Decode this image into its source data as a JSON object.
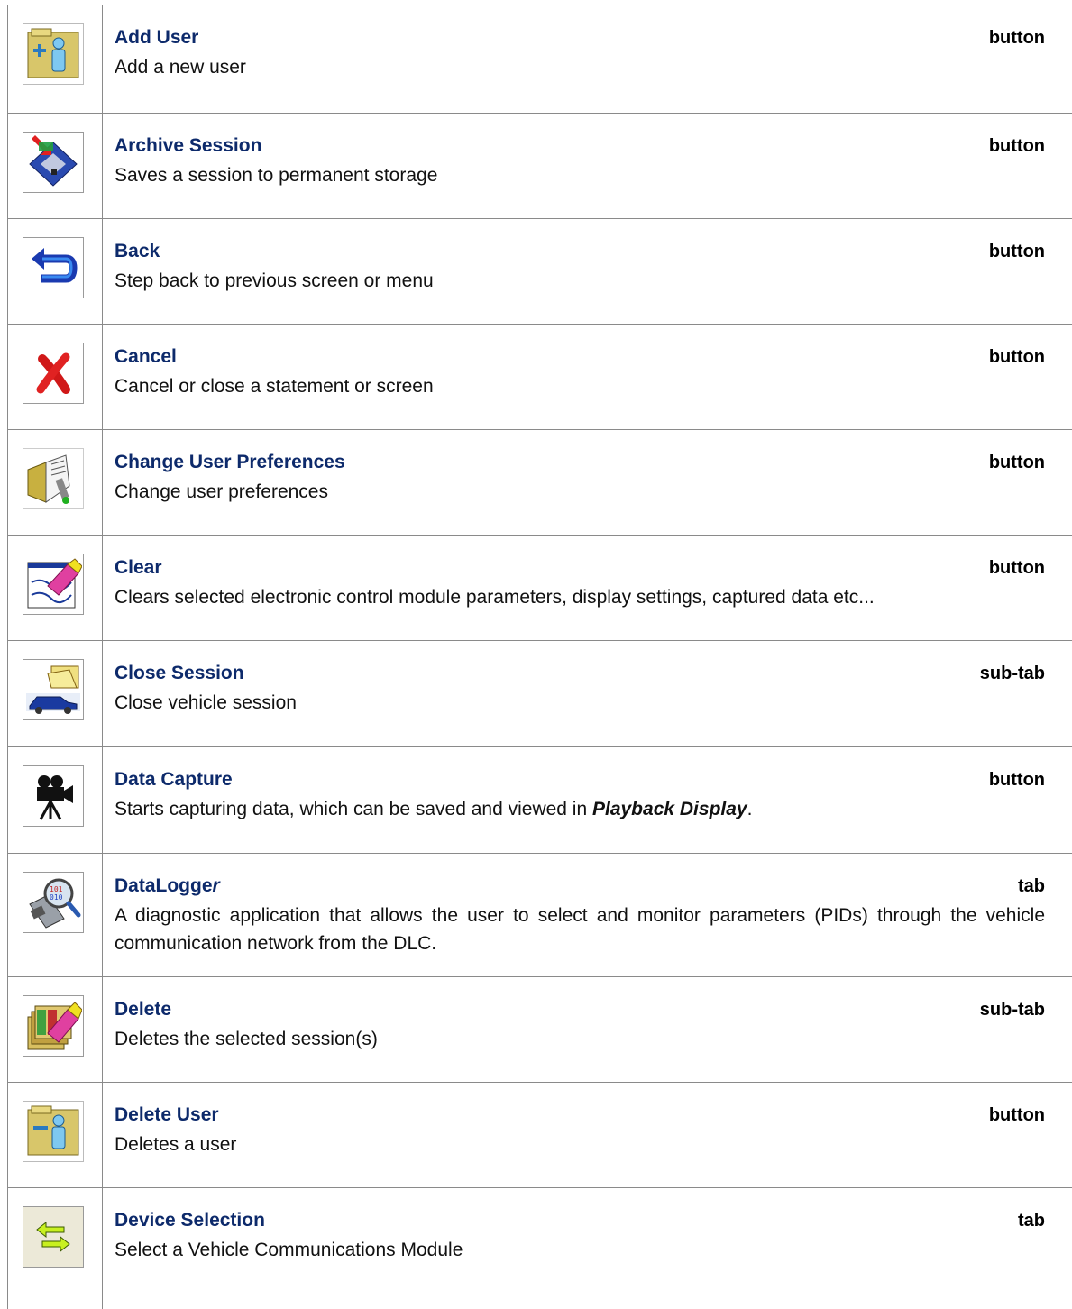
{
  "rows": [
    {
      "icon": "add-user-icon",
      "title": "Add User",
      "kind": "button",
      "desc": "Add a new user"
    },
    {
      "icon": "archive-disk-icon",
      "title": "Archive Session",
      "kind": "button",
      "desc": "Saves a session to permanent storage"
    },
    {
      "icon": "back-arrow-icon",
      "title": "Back",
      "kind": "button",
      "desc": "Step back to previous screen or menu"
    },
    {
      "icon": "red-x-icon",
      "title": "Cancel",
      "kind": "button",
      "desc": "Cancel or close a statement or screen"
    },
    {
      "icon": "preferences-icon",
      "title": "Change User Preferences",
      "kind": "button",
      "desc": "Change user preferences"
    },
    {
      "icon": "eraser-icon",
      "title": "Clear",
      "kind": "button",
      "desc": "Clears selected electronic control module parameters, display settings, captured data etc..."
    },
    {
      "icon": "close-session-icon",
      "title": "Close Session",
      "kind": "sub-tab",
      "desc": "Close vehicle session"
    },
    {
      "icon": "movie-camera-icon",
      "title": "Data Capture",
      "kind": "button",
      "desc_pre": "Starts capturing data, which can be saved and viewed in ",
      "desc_em": "Playback Display",
      "desc_post": "."
    },
    {
      "icon": "datalogger-magnifier-icon",
      "title_main": "DataLogge",
      "title_em": "r",
      "kind": "tab",
      "desc": "A diagnostic application that allows the user to select and monitor parameters (PIDs) through the vehicle communication network from the DLC."
    },
    {
      "icon": "delete-sessions-icon",
      "title": "Delete",
      "kind": "sub-tab",
      "desc": "Deletes the selected session(s)"
    },
    {
      "icon": "delete-user-icon",
      "title": "Delete User",
      "kind": "button",
      "desc": "Deletes a user"
    },
    {
      "icon": "device-arrows-icon",
      "title": "Device Selection",
      "kind": "tab",
      "desc": "Select a Vehicle Communications Module"
    }
  ]
}
